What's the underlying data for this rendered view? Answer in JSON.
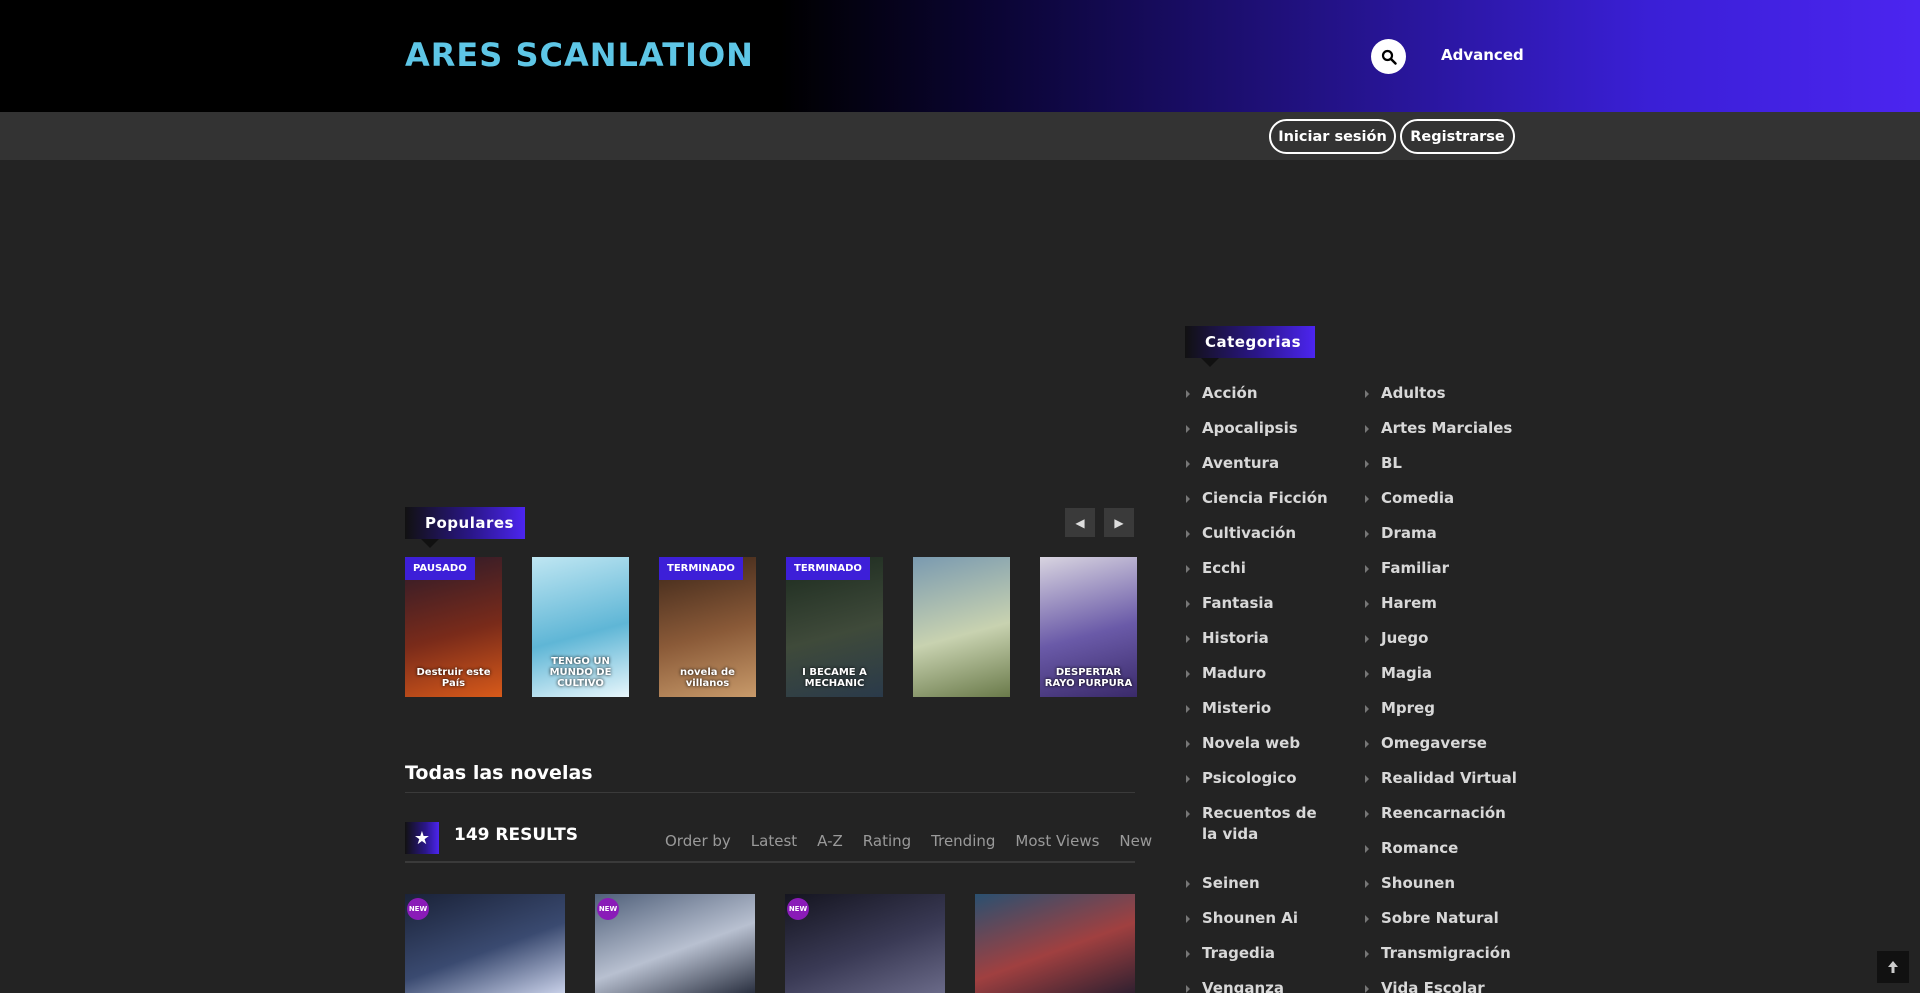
{
  "header": {
    "logo_text": "ARES SCANLATION",
    "search_icon": "search-icon",
    "advanced_label": "Advanced",
    "login_label": "Iniciar sesión",
    "register_label": "Registrarse"
  },
  "populares": {
    "title": "Populares",
    "prev_icon": "caret-left-icon",
    "next_icon": "caret-right-icon",
    "items": [
      {
        "status": "PAUSADO",
        "cover_text": "Destruir este País",
        "colors": [
          "#2b1a2a",
          "#7a2b1a",
          "#d85a1a"
        ]
      },
      {
        "status": "",
        "cover_text": "TENGO UN MUNDO DE CULTIVO",
        "colors": [
          "#bfe6f2",
          "#5fb6d6",
          "#e8f6fb"
        ]
      },
      {
        "status": "TERMINADO",
        "cover_text": "novela de villanos",
        "colors": [
          "#3a2418",
          "#8a5a38",
          "#c89a6a"
        ]
      },
      {
        "status": "TERMINADO",
        "cover_text": "I BECAME A MECHANIC",
        "colors": [
          "#1b2a1e",
          "#3f4a3a",
          "#2a3a4a"
        ]
      },
      {
        "status": "",
        "cover_text": "",
        "colors": [
          "#7a9ab0",
          "#c8d2b0",
          "#6a7a4a"
        ]
      },
      {
        "status": "",
        "cover_text": "DESPERTAR RAYO PURPURA",
        "colors": [
          "#d8d4e0",
          "#6a5aa8",
          "#3a2a6a"
        ]
      }
    ]
  },
  "todas": {
    "title": "Todas las novelas",
    "results": "149 RESULTS",
    "order_by": "Order by",
    "sort_options": [
      "Latest",
      "A-Z",
      "Rating",
      "Trending",
      "Most Views",
      "New"
    ],
    "novels": [
      {
        "badge": "NEW",
        "colors": [
          "#1a2238",
          "#3a4a70",
          "#c8d0e8"
        ]
      },
      {
        "badge": "NEW",
        "colors": [
          "#50607a",
          "#b8c0d0",
          "#2a3040"
        ]
      },
      {
        "badge": "NEW",
        "colors": [
          "#151520",
          "#3a3a55",
          "#6a6a88"
        ]
      },
      {
        "badge": "",
        "colors": [
          "#2a5070",
          "#a04040",
          "#302030"
        ]
      }
    ]
  },
  "categorias": {
    "title": "Categorias",
    "left": [
      "Acción",
      "Apocalipsis",
      "Aventura",
      "Ciencia Ficción",
      "Cultivación",
      "Ecchi",
      "Fantasia",
      "Historia",
      "Maduro",
      "Misterio",
      "Novela web",
      "Psicologico",
      "Recuentos de la vida",
      "Seinen",
      "Shounen Ai",
      "Tragedia",
      "Venganza"
    ],
    "right": [
      "Adultos",
      "Artes Marciales",
      "BL",
      "Comedia",
      "Drama",
      "Familiar",
      "Harem",
      "Juego",
      "Magia",
      "Mpreg",
      "Omegaverse",
      "Realidad Virtual",
      "Reencarnación",
      "Romance",
      "Shounen",
      "Sobre Natural",
      "Transmigración",
      "Vida Escolar"
    ]
  },
  "back_to_top_icon": "arrow-up-icon",
  "accent_color": "#4c25f0"
}
